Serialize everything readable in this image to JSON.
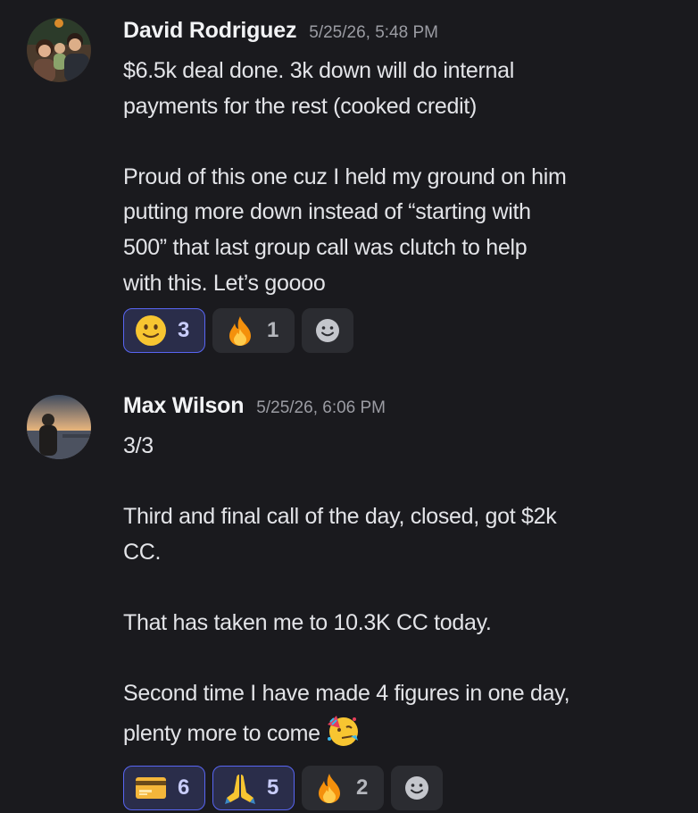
{
  "messages": [
    {
      "author": "David Rodriguez",
      "timestamp": "5/25/26, 5:48 PM",
      "lines": [
        "$6.5k deal done. 3k down will do internal",
        "payments for the rest (cooked credit)",
        "",
        "Proud of this one cuz I held my ground on him",
        "putting more down instead of “starting with",
        "500” that last group call was clutch to help",
        "with this. Let’s goooo"
      ],
      "reactions": [
        {
          "emoji": "slightly-smiling-face",
          "count": "3",
          "active": true
        },
        {
          "emoji": "fire",
          "count": "1",
          "active": false
        }
      ]
    },
    {
      "author": "Max Wilson",
      "timestamp": "5/25/26, 6:06 PM",
      "lines": [
        "3/3",
        "",
        "Third and final call of the day, closed, got $2k",
        "CC.",
        "",
        "That has taken me to 10.3K CC today.",
        "",
        "Second time I have made 4 figures in one day,",
        "plenty more to come"
      ],
      "inline_emoji": "partying-face",
      "reactions": [
        {
          "emoji": "credit-card",
          "count": "6",
          "active": true
        },
        {
          "emoji": "folded-hands",
          "count": "5",
          "active": true
        },
        {
          "emoji": "fire",
          "count": "2",
          "active": false
        }
      ]
    }
  ],
  "colors": {
    "background": "#1a1a1e",
    "reaction_bg": "#2b2c31",
    "reaction_active_bg": "#2a2d4a",
    "reaction_active_border": "#5865f2"
  }
}
